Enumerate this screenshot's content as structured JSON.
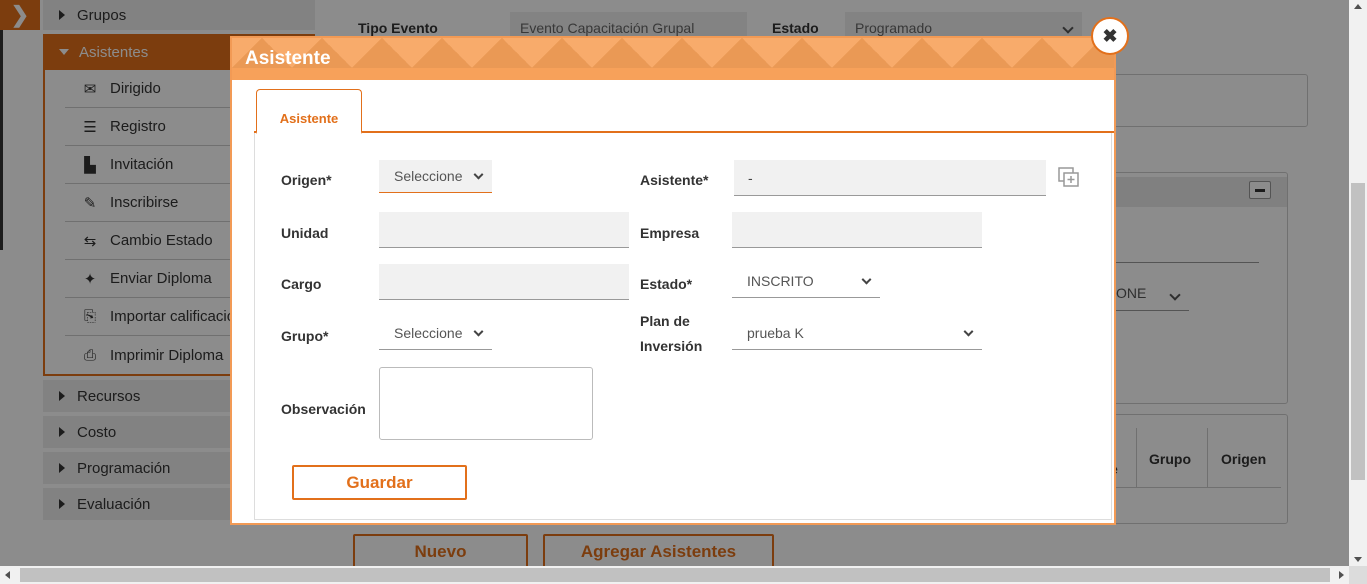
{
  "sidebar": {
    "top_item": "Grupos",
    "active_section": "Asistentes",
    "sub_items": [
      {
        "label": "Dirigido",
        "icon": "envelope-icon"
      },
      {
        "label": "Registro",
        "icon": "list-icon"
      },
      {
        "label": "Invitación",
        "icon": "document-icon"
      },
      {
        "label": "Inscribirse",
        "icon": "pen-icon"
      },
      {
        "label": "Cambio Estado",
        "icon": "arrows-icon"
      },
      {
        "label": "Enviar Diploma",
        "icon": "diploma-send-icon"
      },
      {
        "label": "Importar calificaciones",
        "icon": "import-icon"
      },
      {
        "label": "Imprimir Diploma",
        "icon": "printer-icon"
      }
    ],
    "bottom_items": [
      "Recursos",
      "Costo",
      "Programación",
      "Evaluación"
    ]
  },
  "background": {
    "tipo_evento_label": "Tipo Evento",
    "tipo_evento_value": "Evento Capacitación Grupal",
    "estado_label": "Estado",
    "estado_value": "Programado",
    "partial_select_value": "ONE",
    "table_headers": [
      "Grupo",
      "Origen"
    ],
    "table_header_partial": "e",
    "btn_nuevo": "Nuevo",
    "btn_agregar": "Agregar Asistentes"
  },
  "modal": {
    "title": "Asistente",
    "close_symbol": "✖",
    "tab_label": "Asistente",
    "fields": {
      "origen_label": "Origen*",
      "origen_value": "Seleccione",
      "asistente_label": "Asistente*",
      "asistente_value": "-",
      "unidad_label": "Unidad",
      "unidad_value": "",
      "empresa_label": "Empresa",
      "empresa_value": "",
      "cargo_label": "Cargo",
      "cargo_value": "",
      "estado_label": "Estado*",
      "estado_value": "INSCRITO",
      "grupo_label": "Grupo*",
      "grupo_value": "Seleccione",
      "plan_label_line1": "Plan de",
      "plan_label_line2": "Inversión",
      "plan_value": "prueba K",
      "observacion_label": "Observación",
      "observacion_value": ""
    },
    "save_label": "Guardar"
  },
  "colors": {
    "accent": "#e2701b",
    "header": "#f7a15a"
  }
}
